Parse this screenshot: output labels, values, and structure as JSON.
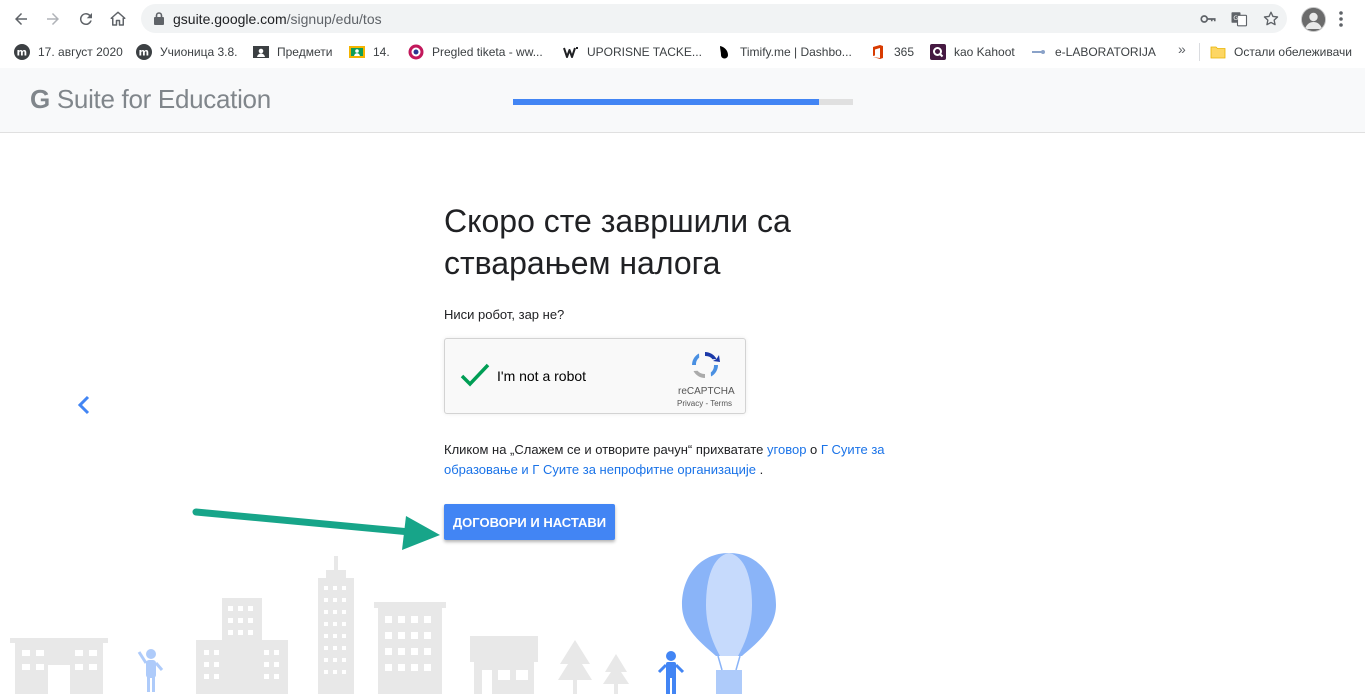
{
  "browser": {
    "url_host": "gsuite.google.com",
    "url_path": "/signup/edu/tos",
    "bookmarks": [
      {
        "label": "17. август 2020",
        "icon": "moodle-icon"
      },
      {
        "label": "Учионица 3.8.",
        "icon": "moodle-icon"
      },
      {
        "label": "Предмети",
        "icon": "classroom-icon"
      },
      {
        "label": "14.",
        "icon": "classroom-icon"
      },
      {
        "label": "Pregled tiketa - ww...",
        "icon": "ticket-icon"
      },
      {
        "label": "UPORISNE TACKE...",
        "icon": "wix-icon"
      },
      {
        "label": "Timify.me | Dashbo...",
        "icon": "timify-icon"
      },
      {
        "label": "365",
        "icon": "office-icon"
      },
      {
        "label": "kao Kahoot",
        "icon": "quizizz-icon"
      },
      {
        "label": "e-LABORATORIJA",
        "icon": "lab-icon"
      }
    ],
    "more_bookmarks": "»",
    "other_bookmarks": "Остали обележивачи"
  },
  "header": {
    "logo_g": "G",
    "logo_text": "Suite for Education",
    "progress_fraction": 0.9
  },
  "main": {
    "title": "Скоро сте завршили са стварањем налога",
    "robot_question": "Ниси робот, зар не?",
    "recaptcha": {
      "label": "I'm not a robot",
      "brand": "reCAPTCHA",
      "privacy": "Privacy",
      "separator": " - ",
      "terms": "Terms"
    },
    "tos": {
      "prefix": "Кликом на „Слажем се и отворите рачун“ прихватате ",
      "link_agreement": "уговор",
      "middle": " о ",
      "link_products": "Г Суите за образовање и Г Суите за непрофитне организације",
      "suffix": " ."
    },
    "button_label": "ДОГОВОРИ И НАСТАВИ"
  },
  "colors": {
    "accent": "#4285f4",
    "link": "#1a73e8",
    "annotation_arrow": "#17a589",
    "recaptcha_check": "#009e55"
  }
}
